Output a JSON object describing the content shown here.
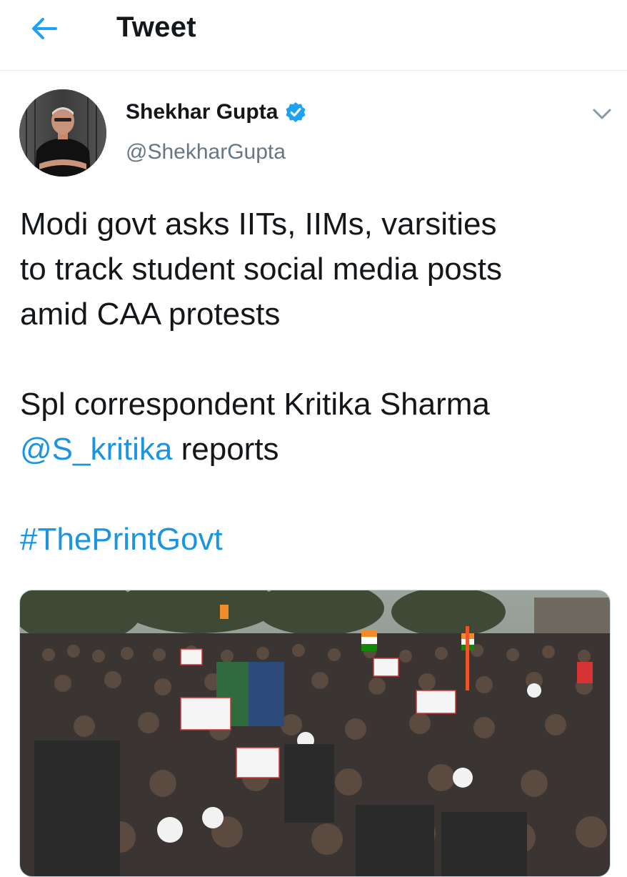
{
  "header": {
    "title": "Tweet",
    "back_icon": "arrow-left-icon"
  },
  "author": {
    "display_name": "Shekhar Gupta",
    "handle": "@ShekharGupta",
    "verified": true,
    "verified_icon": "verified-badge-icon"
  },
  "tweet": {
    "line1": "Modi govt asks IITs, IIMs, varsities",
    "line2": "to track student social media posts",
    "line3": "amid CAA protests",
    "line4": "Spl correspondent Kritika Sharma",
    "mention": "@S_kritika",
    "mention_suffix": " reports",
    "hashtag": "#ThePrintGovt"
  },
  "colors": {
    "accent": "#1da1f2",
    "link": "#1b95e0",
    "text": "#14171a",
    "secondary": "#657786"
  },
  "menu_icon": "chevron-down-icon",
  "media_description": "photo"
}
